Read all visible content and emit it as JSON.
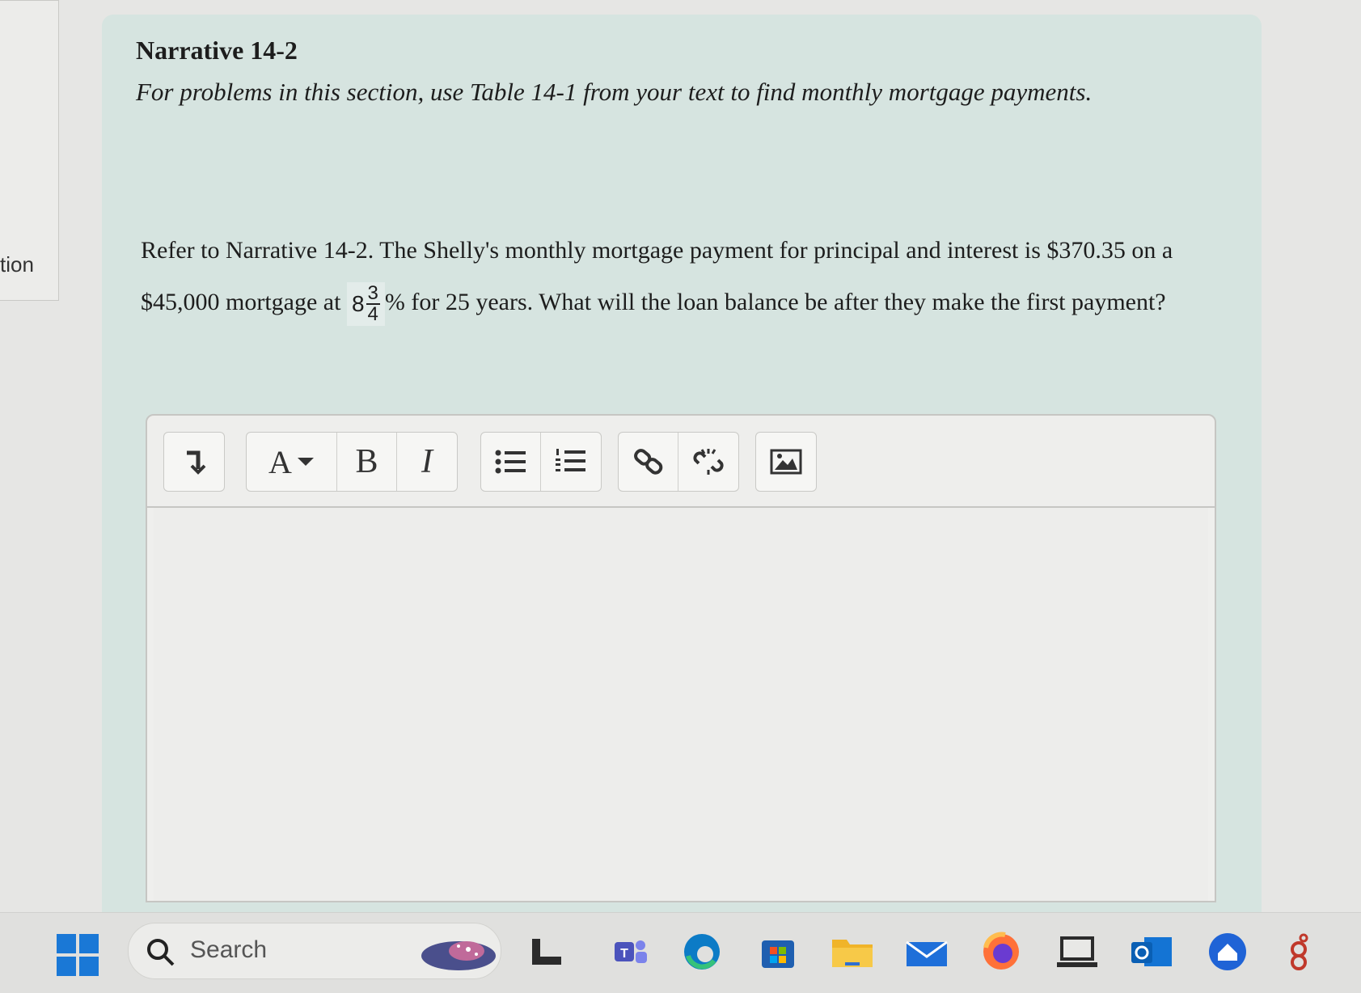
{
  "sidebar": {
    "label": "tion"
  },
  "narrative": {
    "title": "Narrative 14-2",
    "text": "For problems in this section, use Table 14-1 from your text to find monthly mortgage payments."
  },
  "question": {
    "part1": "Refer to Narrative 14-2. The Shelly's monthly mortgage payment for principal and interest is $370.35 on a $45,000 mortgage at",
    "rate_whole": "8",
    "rate_num": "3",
    "rate_den": "4",
    "part2": "% for 25 years. What will the loan balance be after they make the first payment?"
  },
  "toolbar": {
    "font_label": "A",
    "bold_label": "B",
    "italic_label": "I",
    "buttons": [
      "insert-arrow",
      "font",
      "bold",
      "italic",
      "bulleted-list",
      "numbered-list",
      "link",
      "unlink",
      "image"
    ]
  },
  "editor": {
    "value": ""
  },
  "taskbar": {
    "search_placeholder": "Search",
    "apps": [
      "file-explorer-icon",
      "teams-icon",
      "edge-icon",
      "store-icon",
      "folder-icon",
      "mail-icon",
      "firefox-icon",
      "laptop-app-icon",
      "outlook-icon",
      "home-app-icon",
      "more-icon"
    ]
  }
}
